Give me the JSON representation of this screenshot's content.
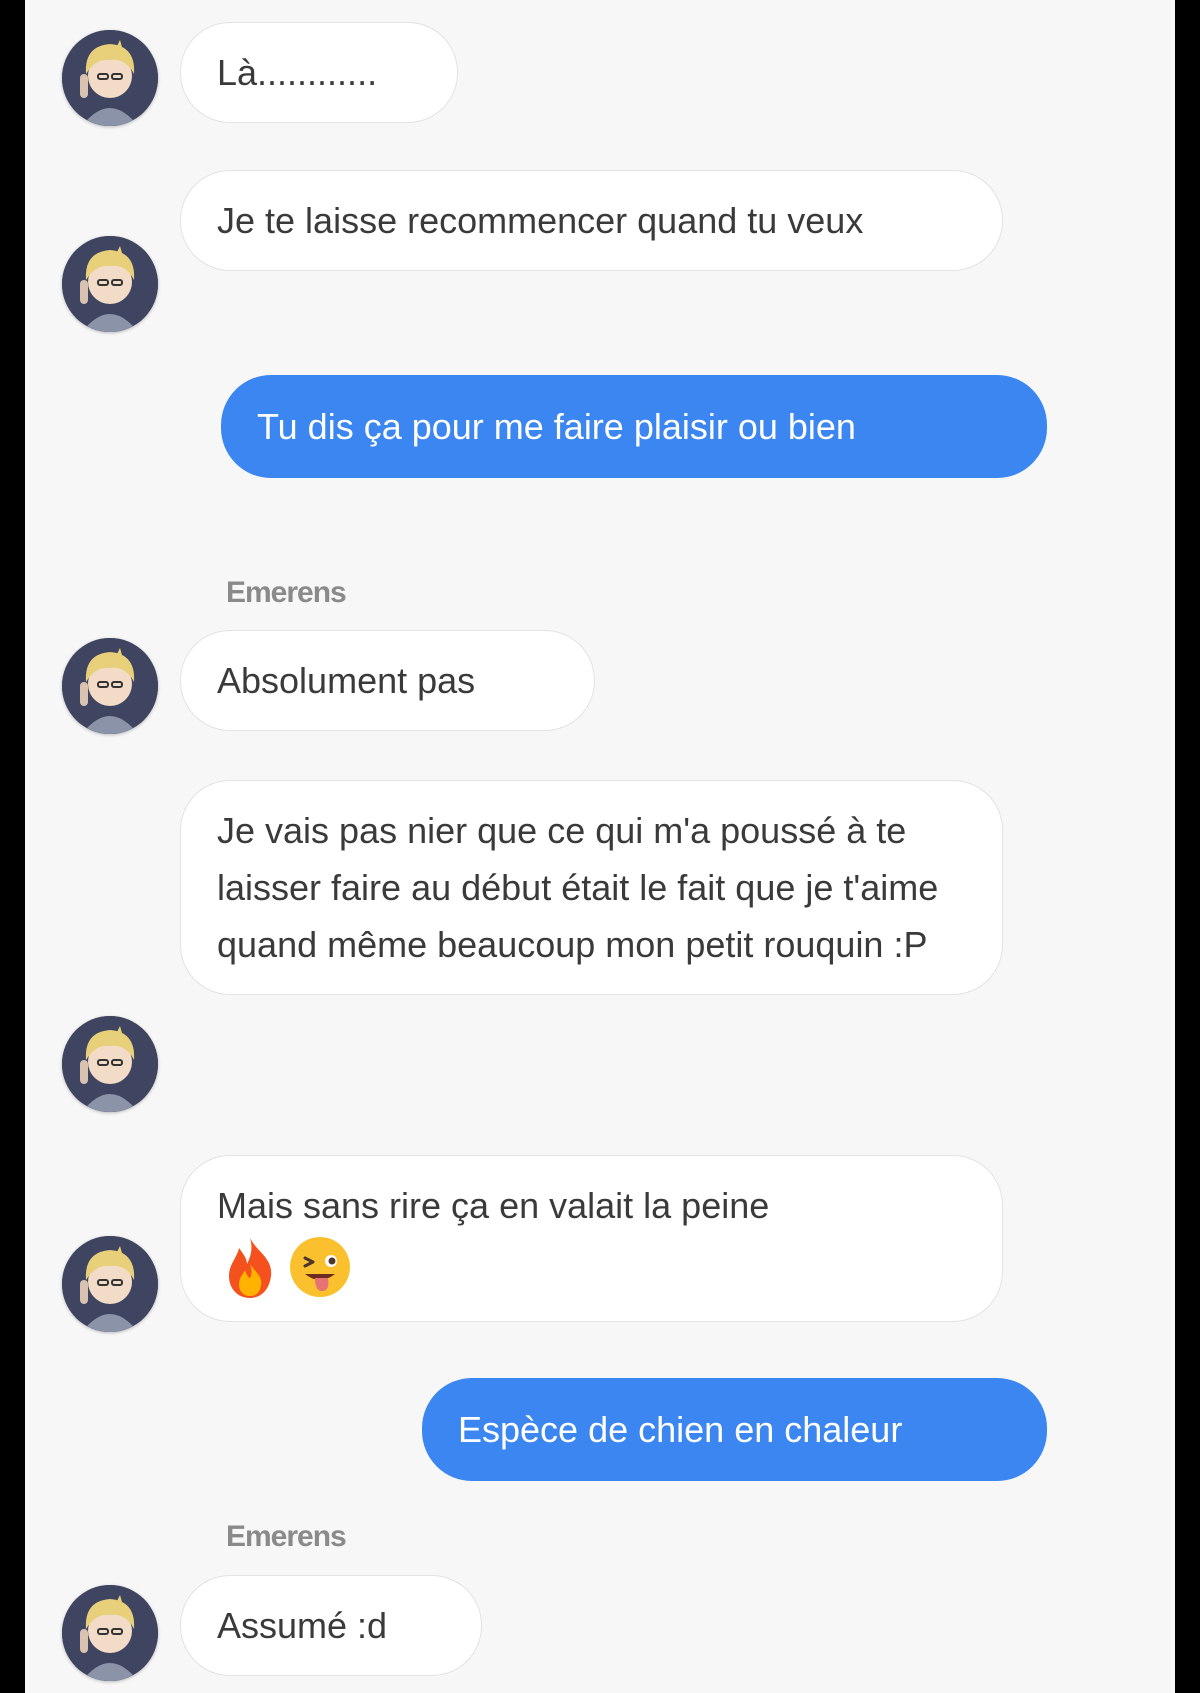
{
  "conversation": {
    "contact_name": "Emerens",
    "messages": [
      {
        "direction": "in",
        "text": "Là............"
      },
      {
        "direction": "in",
        "text": "Je te laisse recommencer quand tu veux"
      },
      {
        "direction": "out",
        "text": "Tu dis ça pour me faire plaisir ou bien"
      },
      {
        "direction": "in",
        "sender": "Emerens",
        "text": "Absolument pas"
      },
      {
        "direction": "in",
        "text": "Je vais pas nier que ce qui m'a poussé à te laisser faire au début était le fait que je t'aime quand même beaucoup mon petit rouquin :P"
      },
      {
        "direction": "in",
        "text": "Mais sans rire ça en valait la peine",
        "emojis": [
          "fire-emoji",
          "winking-face-with-tongue-emoji"
        ]
      },
      {
        "direction": "out",
        "text": "Espèce de chien en chaleur"
      },
      {
        "direction": "in",
        "sender": "Emerens",
        "text": "Assumé :d"
      }
    ]
  },
  "colors": {
    "panel_background": "#f7f7f7",
    "incoming_bubble": "#ffffff",
    "outgoing_bubble": "#3b86f1",
    "incoming_text": "#3a3a3a",
    "outgoing_text": "#ffffff",
    "sender_name": "#8a8a8a"
  }
}
